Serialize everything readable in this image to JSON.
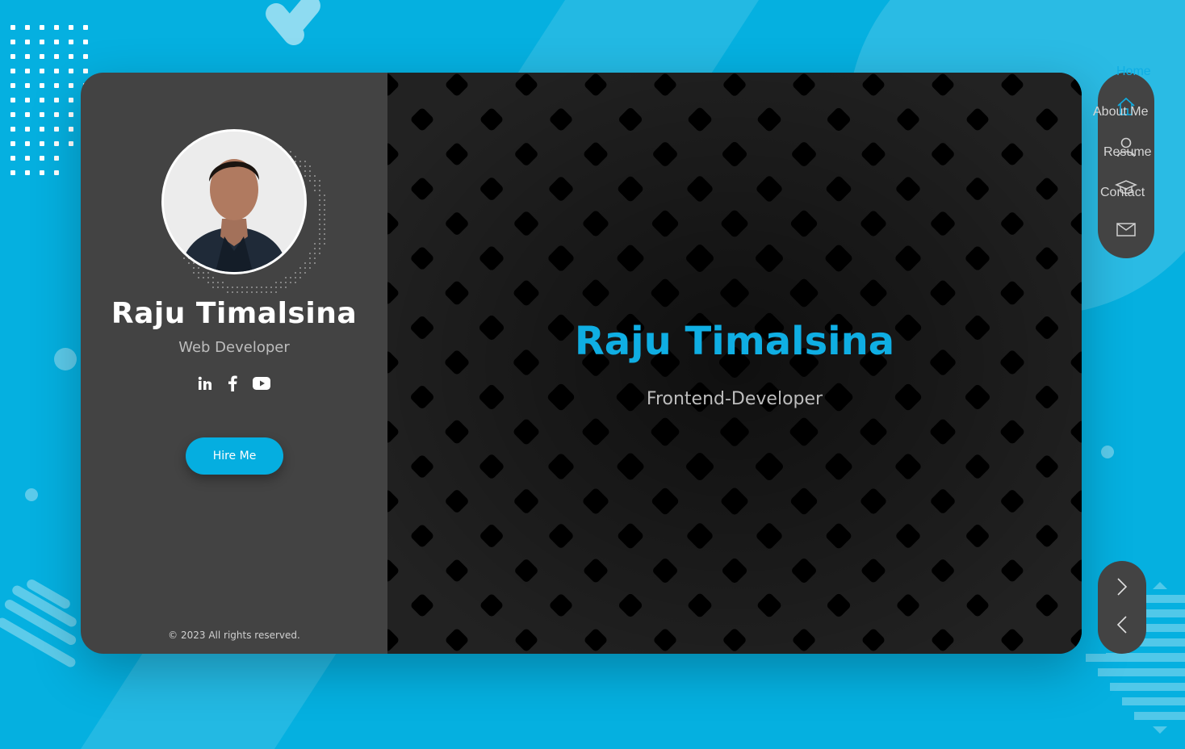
{
  "profile": {
    "name": "Raju Timalsina",
    "role": "Web Developer",
    "hire_label": "Hire Me",
    "copyright": "© 2023 All rights reserved.",
    "socials": [
      "linkedin-icon",
      "facebook-icon",
      "youtube-icon"
    ]
  },
  "hero": {
    "title": "Raju Timalsina",
    "subtitle": "Frontend-Developer"
  },
  "nav": {
    "items": [
      {
        "label": "Home",
        "icon": "home-icon",
        "active": true
      },
      {
        "label": "About Me",
        "icon": "user-icon",
        "active": false
      },
      {
        "label": "Resume",
        "icon": "graduation-cap-icon",
        "active": false
      },
      {
        "label": "Contact",
        "icon": "mail-icon",
        "active": false
      }
    ]
  },
  "pager": {
    "next_icon": "chevron-right-icon",
    "prev_icon": "chevron-left-icon"
  },
  "colors": {
    "background": "#05b0e0",
    "accent": "#0faee3",
    "sidebar": "#434343",
    "main": "#212121"
  }
}
